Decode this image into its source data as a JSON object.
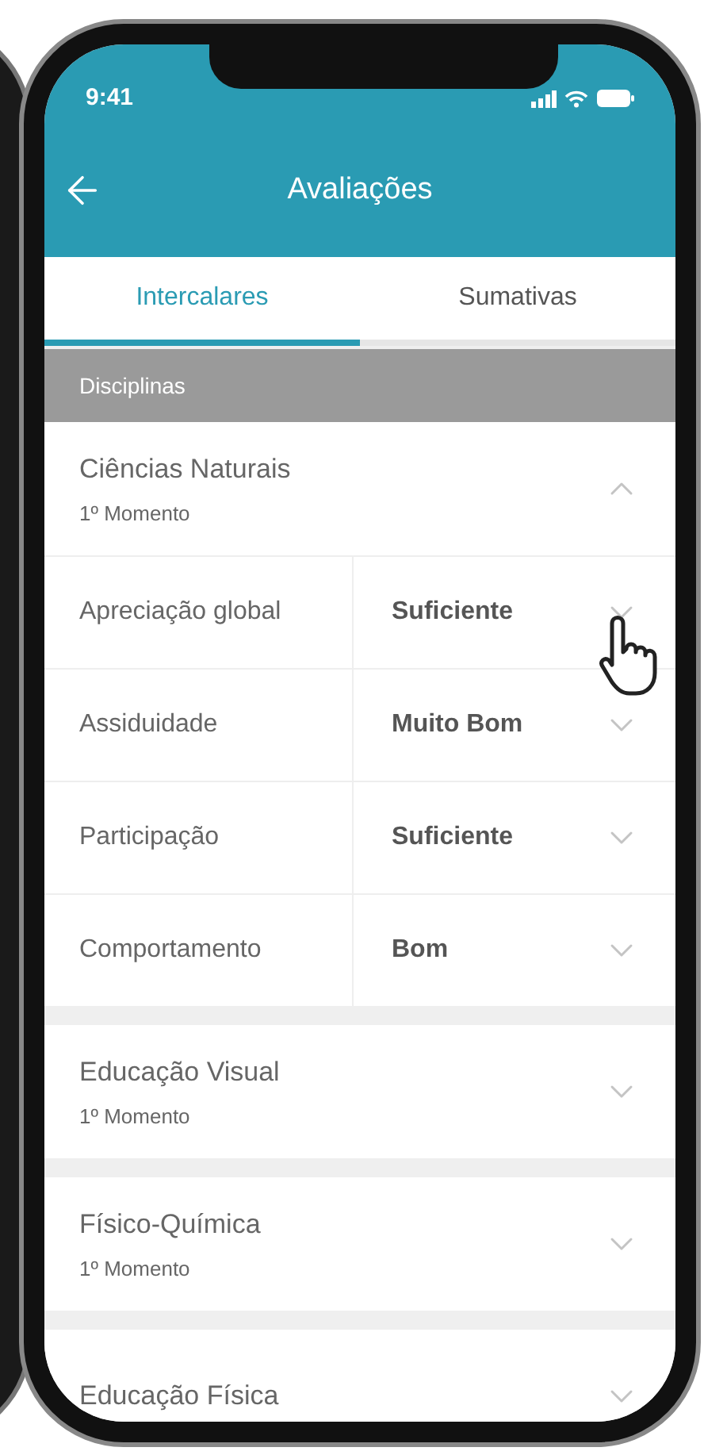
{
  "status_bar": {
    "time": "9:41"
  },
  "header": {
    "title": "Avaliações"
  },
  "tabs": [
    {
      "label": "Intercalares",
      "selected": true
    },
    {
      "label": "Sumativas",
      "selected": false
    }
  ],
  "section_header": "Disciplinas",
  "subjects": [
    {
      "name": "Ciências Naturais",
      "subtitle": "1º Momento",
      "expanded": true,
      "grades": [
        {
          "criterion": "Apreciação global",
          "value": "Suficiente"
        },
        {
          "criterion": "Assiduidade",
          "value": "Muito Bom"
        },
        {
          "criterion": "Participação",
          "value": "Suficiente"
        },
        {
          "criterion": "Comportamento",
          "value": "Bom"
        }
      ]
    },
    {
      "name": "Educação Visual",
      "subtitle": "1º Momento",
      "expanded": false
    },
    {
      "name": "Físico-Química",
      "subtitle": "1º Momento",
      "expanded": false
    },
    {
      "name": "Educação Física",
      "expanded": false
    }
  ]
}
